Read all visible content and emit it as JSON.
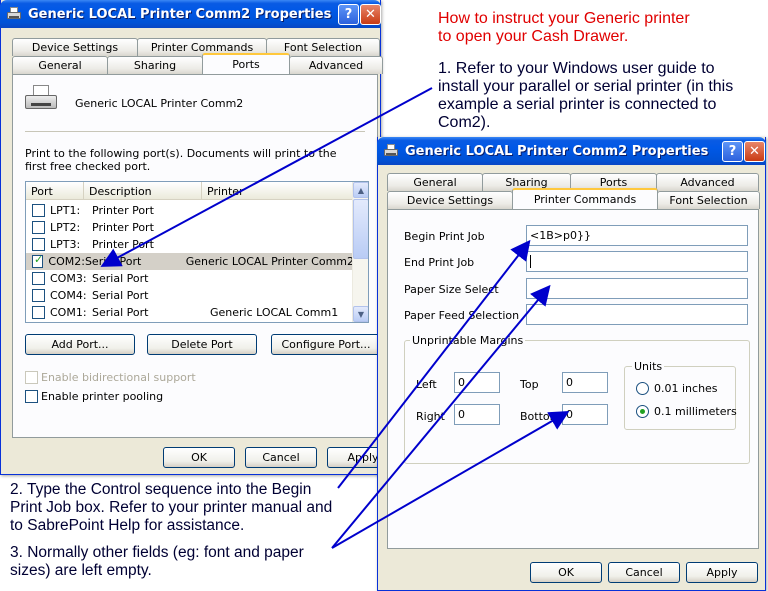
{
  "window1": {
    "title": "Generic LOCAL Printer Comm2 Properties",
    "help_btn": "?",
    "close_btn": "✕",
    "tabs_back": [
      "Device Settings",
      "Printer Commands",
      "Font Selection"
    ],
    "tabs_front": [
      "General",
      "Sharing",
      "Ports",
      "Advanced"
    ],
    "printer_name": "Generic LOCAL Printer Comm2",
    "instruction": "Print to the following port(s). Documents will print to the first free checked port.",
    "columns": [
      "Port",
      "Description",
      "Printer"
    ],
    "ports": [
      {
        "port": "LPT1:",
        "desc": "Printer Port",
        "printer": "",
        "checked": false
      },
      {
        "port": "LPT2:",
        "desc": "Printer Port",
        "printer": "",
        "checked": false
      },
      {
        "port": "LPT3:",
        "desc": "Printer Port",
        "printer": "",
        "checked": false
      },
      {
        "port": "COM2:",
        "desc": "Serial Port",
        "printer": "Generic LOCAL Printer Comm2",
        "checked": true
      },
      {
        "port": "COM3:",
        "desc": "Serial Port",
        "printer": "",
        "checked": false
      },
      {
        "port": "COM4:",
        "desc": "Serial Port",
        "printer": "",
        "checked": false
      },
      {
        "port": "COM1:",
        "desc": "Serial Port",
        "printer": "Generic LOCAL Comm1",
        "checked": false
      }
    ],
    "add_port": "Add Port...",
    "delete_port": "Delete Port",
    "configure_port": "Configure Port...",
    "bidirectional": "Enable bidirectional support",
    "pooling": "Enable printer pooling",
    "ok": "OK",
    "cancel": "Cancel",
    "apply": "Apply"
  },
  "window2": {
    "title": "Generic LOCAL Printer Comm2 Properties",
    "help_btn": "?",
    "close_btn": "✕",
    "tabs_back": [
      "General",
      "Sharing",
      "Ports",
      "Advanced"
    ],
    "tabs_front": [
      "Device Settings",
      "Printer Commands",
      "Font Selection"
    ],
    "begin_print_job_label": "Begin Print Job",
    "begin_print_job_value": "<1B>p0}}",
    "end_print_job_label": "End Print Job",
    "end_print_job_value": "",
    "paper_size_label": "Paper Size Select",
    "paper_size_value": "",
    "paper_feed_label": "Paper Feed Selection",
    "paper_feed_value": "",
    "margins_title": "Unprintable Margins",
    "left_label": "Left",
    "left_value": "0",
    "top_label": "Top",
    "top_value": "0",
    "right_label": "Right",
    "right_value": "0",
    "bottom_label": "Bottom",
    "bottom_value": "0",
    "units_title": "Units",
    "unit_inches": "0.01 inches",
    "unit_mm": "0.1 millimeters",
    "selected_unit": "mm",
    "ok": "OK",
    "cancel": "Cancel",
    "apply": "Apply"
  },
  "notes": {
    "heading": [
      "How to instruct your Generic printer",
      "to open your Cash Drawer."
    ],
    "step1": [
      "1. Refer to your Windows user guide to",
      "install your parallel or serial printer (in this",
      "example a serial printer is connected to",
      "Com2)."
    ],
    "step2": [
      "2. Type the Control sequence into the Begin",
      "Print Job box. Refer to your printer manual and",
      "to SabrePoint Help for assistance."
    ],
    "step3": [
      "3. Normally other fields (eg: font and paper",
      "sizes) are left empty."
    ]
  },
  "colors": {
    "titlebar": "#0058e6",
    "face": "#ece9d8",
    "heading_text": "#e00000",
    "annotation_arrow": "#0000cc"
  }
}
